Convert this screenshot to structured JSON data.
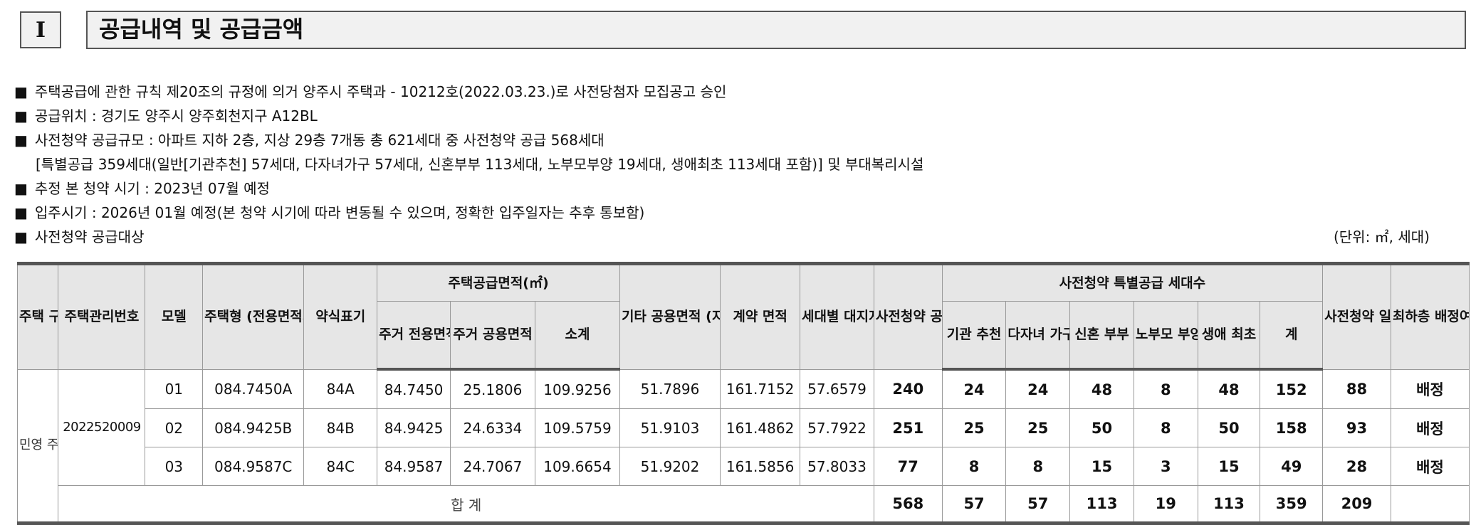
{
  "section": {
    "number": "I",
    "title": "공급내역 및 공급금액"
  },
  "notes": [
    "주택공급에 관한 규칙 제20조의 규정에 의거 양주시 주택과 - 10212호(2022.03.23.)로 사전당첨자 모집공고 승인",
    "공급위치 : 경기도 양주시 양주회천지구 A12BL",
    "사전청약 공급규모 : 아파트 지하 2층, 지상 29층 7개동 총 621세대 중 사전청약 공급 568세대",
    "추정 본 청약 시기 : 2023년 07월 예정",
    "입주시기 : 2026년 01월 예정(본 청약 시기에 따라 변동될 수 있으며, 정확한 입주일자는 추후 통보함)",
    "사전청약 공급대상"
  ],
  "note_continuation": "[특별공급 359세대(일반[기관추천] 57세대, 다자녀가구 57세대, 신혼부부 113세대, 노부모부양 19세대, 생애최초 113세대 포함)] 및 부대복리시설",
  "bullet": "■",
  "unit": "(단위: ㎡, 세대)",
  "table": {
    "headers": {
      "housing_type": "주택\n구분",
      "mgmt_no": "주택관리번호",
      "model": "모델",
      "housing_size": "주택형\n(전용면적기준)",
      "short": "약식표기",
      "supply_area_group": "주택공급면적(㎡)",
      "exclusive": "주거\n전용면적",
      "common": "주거\n공용면적",
      "subtotal": "소계",
      "other_common": "기타\n공용면적\n(지하주차장등)",
      "contract": "계약\n면적",
      "land_share": "세대별\n대지지분",
      "pre_supply": "사전청약\n공급\n세대수",
      "special_group": "사전청약 특별공급 세대수",
      "inst": "기관\n추천",
      "multi_child": "다자녀\n가구",
      "newlywed": "신혼\n부부",
      "elderly": "노부모\n부양",
      "first_time": "생애\n최초",
      "sum": "계",
      "general": "사전청약\n일반공급\n세대수",
      "lowest_floor": "최하층\n배정여부"
    },
    "housing_type_value": "민영\n주택",
    "mgmt_no_value": "2022520009",
    "rows": [
      {
        "model": "01",
        "size": "084.7450A",
        "short": "84A",
        "exclusive": "84.7450",
        "common": "25.1806",
        "subtotal": "109.9256",
        "other": "51.7896",
        "contract": "161.7152",
        "land": "57.6579",
        "pre": "240",
        "inst": "24",
        "multi": "24",
        "newlywed": "48",
        "elderly": "8",
        "first": "48",
        "sum": "152",
        "general": "88",
        "lowest": "배정"
      },
      {
        "model": "02",
        "size": "084.9425B",
        "short": "84B",
        "exclusive": "84.9425",
        "common": "24.6334",
        "subtotal": "109.5759",
        "other": "51.9103",
        "contract": "161.4862",
        "land": "57.7922",
        "pre": "251",
        "inst": "25",
        "multi": "25",
        "newlywed": "50",
        "elderly": "8",
        "first": "50",
        "sum": "158",
        "general": "93",
        "lowest": "배정"
      },
      {
        "model": "03",
        "size": "084.9587C",
        "short": "84C",
        "exclusive": "84.9587",
        "common": "24.7067",
        "subtotal": "109.6654",
        "other": "51.9202",
        "contract": "161.5856",
        "land": "57.8033",
        "pre": "77",
        "inst": "8",
        "multi": "8",
        "newlywed": "15",
        "elderly": "3",
        "first": "15",
        "sum": "49",
        "general": "28",
        "lowest": "배정"
      }
    ],
    "total": {
      "label": "합 계",
      "pre": "568",
      "inst": "57",
      "multi": "57",
      "newlywed": "113",
      "elderly": "19",
      "first": "113",
      "sum": "359",
      "general": "209",
      "lowest": ""
    }
  }
}
